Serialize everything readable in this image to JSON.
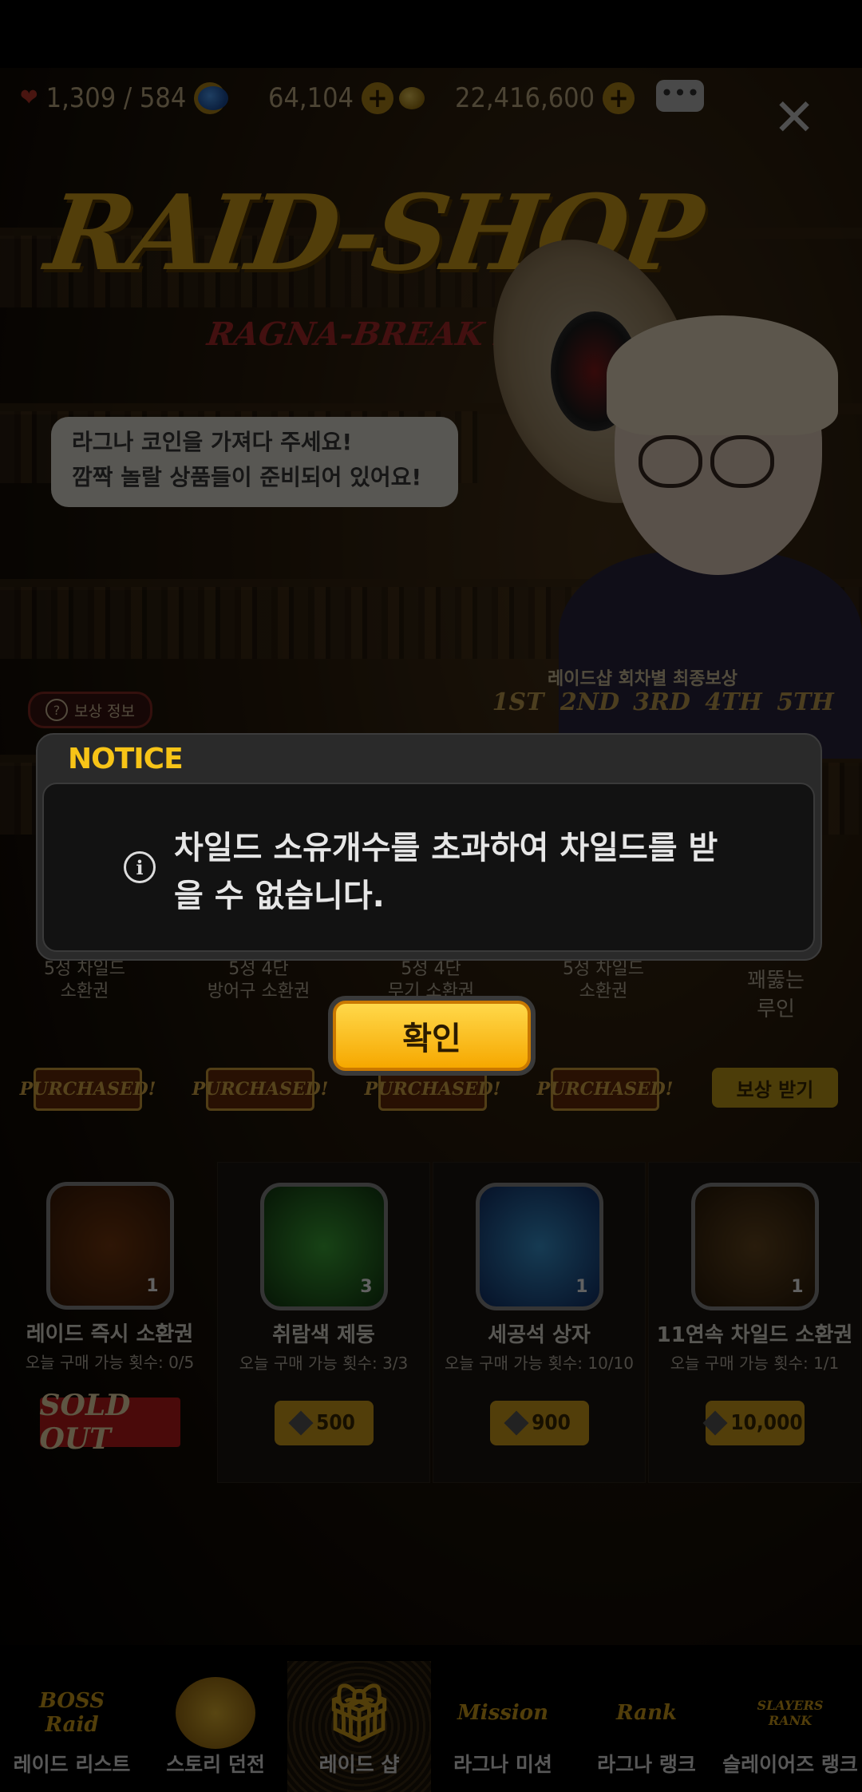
{
  "status_bar": {
    "stamina": "1,309 / 584",
    "gems": "64,104",
    "gold": "22,416,600"
  },
  "banner": {
    "logo_main": "RAID-SHOP",
    "logo_sub": "RAGNA-BREAK LIMITED",
    "bubble_line1": "라그나 코인을 가져다 주세요!",
    "bubble_line2": "깜짝 놀랄 상품들이 준비되어 있어요!"
  },
  "reward_info_label": "보상 정보",
  "rounds": {
    "title": "레이드샵 회차별 최종보상",
    "labels": [
      "1ST",
      "2ND",
      "3RD",
      "4TH",
      "5TH"
    ]
  },
  "round_items": [
    {
      "name": "5성 차일드\n소환권",
      "button": "PURCHASED!"
    },
    {
      "name": "5성 4단\n방어구 소환권",
      "button": "PURCHASED!"
    },
    {
      "name": "5성 4단\n무기 소환권",
      "button": "PURCHASED!"
    },
    {
      "name": "5성 차일드\n소환권",
      "button": "PURCHASED!"
    },
    {
      "name": "꽤뚫는\n루인",
      "button": "보상 받기"
    }
  ],
  "shop_items": [
    {
      "title": "레이드 즉시 소환권",
      "limit": "오늘 구매 가능 횟수: 0/5",
      "count": "1",
      "sold_out": "SOLD OUT",
      "price": ""
    },
    {
      "title": "취람색 제둥",
      "limit": "오늘 구매 가능 횟수: 3/3",
      "count": "3",
      "price": "500"
    },
    {
      "title": "세공석 상자",
      "limit": "오늘 구매 가능 횟수: 10/10",
      "count": "1",
      "price": "900"
    },
    {
      "title": "11연속 차일드 소환권",
      "limit": "오늘 구매 가능 횟수: 1/1",
      "count": "1",
      "price": "10,000"
    }
  ],
  "bottom_nav": [
    {
      "label": "레이드 리스트",
      "icon": "BOSS Raid"
    },
    {
      "label": "스토리 던전",
      "icon": ""
    },
    {
      "label": "레이드 샵",
      "icon": "",
      "active": true
    },
    {
      "label": "라그나 미션",
      "icon": "Mission"
    },
    {
      "label": "라그나 랭크",
      "icon": "Rank"
    },
    {
      "label": "슬레이어즈 랭크",
      "icon": "SLAYERS RANK"
    }
  ],
  "modal": {
    "title": "NOTICE",
    "message": "차일드 소유개수를 초과하여 차일드를 받을 수 없습니다.",
    "ok_label": "확인"
  },
  "colors": {
    "accent": "#F7C417",
    "button_gold": "#FFD84A"
  }
}
